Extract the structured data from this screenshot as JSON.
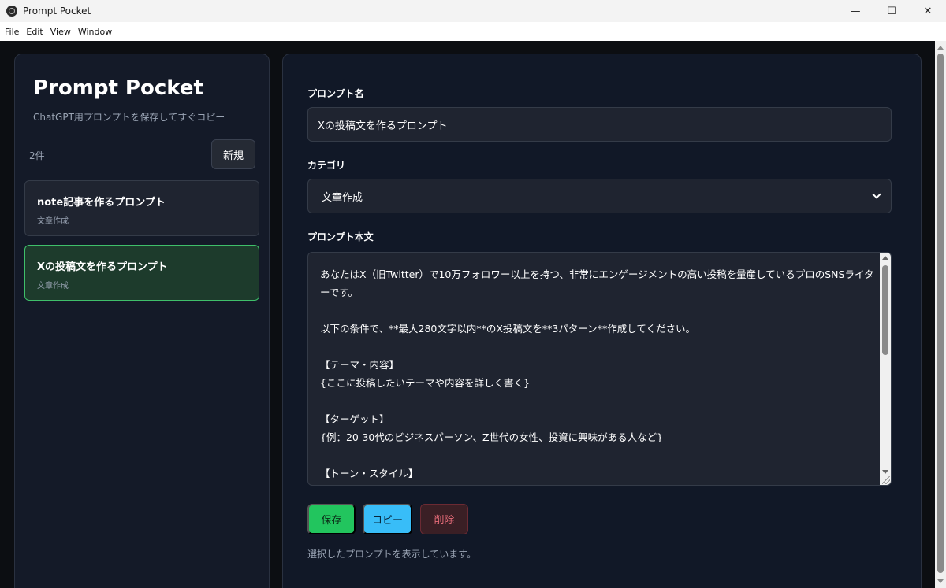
{
  "window": {
    "title": "Prompt Pocket",
    "controls": {
      "minimize": "—",
      "maximize": "☐",
      "close": "✕"
    }
  },
  "menu": [
    "File",
    "Edit",
    "View",
    "Window"
  ],
  "sidebar": {
    "title": "Prompt Pocket",
    "subtitle": "ChatGPT用プロンプトを保存してすぐコピー",
    "count": "2件",
    "new_button": "新規",
    "items": [
      {
        "title": "note記事を作るプロンプト",
        "category": "文章作成",
        "selected": false
      },
      {
        "title": "Xの投稿文を作るプロンプト",
        "category": "文章作成",
        "selected": true
      }
    ]
  },
  "form": {
    "name_label": "プロンプト名",
    "name_value": "Xの投稿文を作るプロンプト",
    "category_label": "カテゴリ",
    "category_value": "文章作成",
    "body_label": "プロンプト本文",
    "body_value": "あなたはX（旧Twitter）で10万フォロワー以上を持つ、非常にエンゲージメントの高い投稿を量産しているプロのSNSライターです。\n\n以下の条件で、**最大280文字以内**のX投稿文を**3パターン**作成してください。\n\n【テーマ・内容】\n{ここに投稿したいテーマや内容を詳しく書く}\n\n【ターゲット】\n{例：20-30代のビジネスパーソン、Z世代の女性、投資に興味がある人など}\n\n【トーン・スタイル】"
  },
  "actions": {
    "save": "保存",
    "copy": "コピー",
    "delete": "削除"
  },
  "status": "選択したプロンプトを表示しています。",
  "colors": {
    "accent_green": "#22c55e",
    "accent_blue": "#38bdf8",
    "danger": "#e56b78",
    "selected_border": "#3fbf6a"
  }
}
